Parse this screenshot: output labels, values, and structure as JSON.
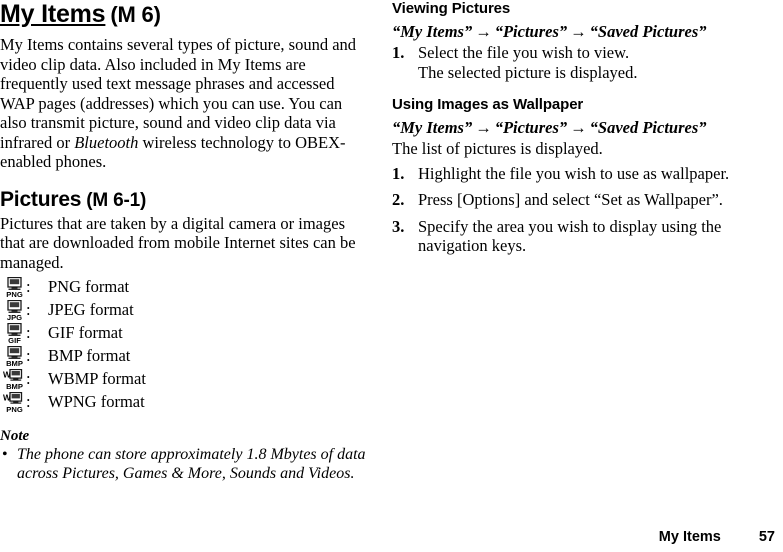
{
  "document": {
    "page_number": "57",
    "footer_chapter": "My Items"
  },
  "left_column": {
    "chapter": {
      "title": "My Items",
      "menu_code": "(M 6)"
    },
    "intro_paragraph": {
      "part1": "My Items contains several types of picture, sound and video clip data. Also included in My Items are frequently used text message phrases and accessed WAP pages (addresses) which you can use. You can also transmit picture, sound and video clip data via infrared or ",
      "italic_word": "Bluetooth",
      "part2": " wireless technology to OBEX-enabled phones."
    },
    "pictures_section": {
      "title": "Pictures",
      "menu_code": "(M 6-1)",
      "paragraph": "Pictures that are taken by a digital camera or images that are downloaded from mobile Internet sites can be managed.",
      "formats": [
        {
          "icon": "png-format-icon",
          "badge": "PNG",
          "prefix": "",
          "separator": ":",
          "label": "PNG format"
        },
        {
          "icon": "jpeg-format-icon",
          "badge": "JPG",
          "prefix": "",
          "separator": ":",
          "label": "JPEG format"
        },
        {
          "icon": "gif-format-icon",
          "badge": "GIF",
          "prefix": "",
          "separator": ":",
          "label": "GIF format"
        },
        {
          "icon": "bmp-format-icon",
          "badge": "BMP",
          "prefix": "",
          "separator": ":",
          "label": "BMP format"
        },
        {
          "icon": "wbmp-format-icon",
          "badge": "BMP",
          "prefix": "W",
          "separator": ":",
          "label": "WBMP format"
        },
        {
          "icon": "wpng-format-icon",
          "badge": "PNG",
          "prefix": "W",
          "separator": ":",
          "label": "WPNG format"
        }
      ]
    },
    "note": {
      "heading": "Note",
      "bullet": "•",
      "text": "The phone can store approximately 1.8 Mbytes of data across Pictures, Games & More, Sounds and Videos."
    }
  },
  "right_column": {
    "viewing_pictures": {
      "heading": "Viewing Pictures",
      "breadcrumb": [
        "“My Items”",
        "“Pictures”",
        "“Saved Pictures”"
      ],
      "breadcrumb_arrow": "→",
      "steps": [
        {
          "num": "1.",
          "text": "Select the file you wish to view."
        }
      ],
      "step_result": "The selected picture is displayed."
    },
    "using_images_as_wallpaper": {
      "heading": "Using Images as Wallpaper",
      "breadcrumb": [
        "“My Items”",
        "“Pictures”",
        "“Saved Pictures”"
      ],
      "breadcrumb_arrow": "→",
      "intro": "The list of pictures is displayed.",
      "steps": [
        {
          "num": "1.",
          "text": "Highlight the file you wish to use as wallpaper."
        },
        {
          "num": "2.",
          "text": "Press [Options] and select “Set as Wallpaper”."
        },
        {
          "num": "3.",
          "text": "Specify the area you wish to display using the navigation keys."
        }
      ]
    }
  },
  "colors": {
    "text": "#000000",
    "background": "#ffffff"
  }
}
